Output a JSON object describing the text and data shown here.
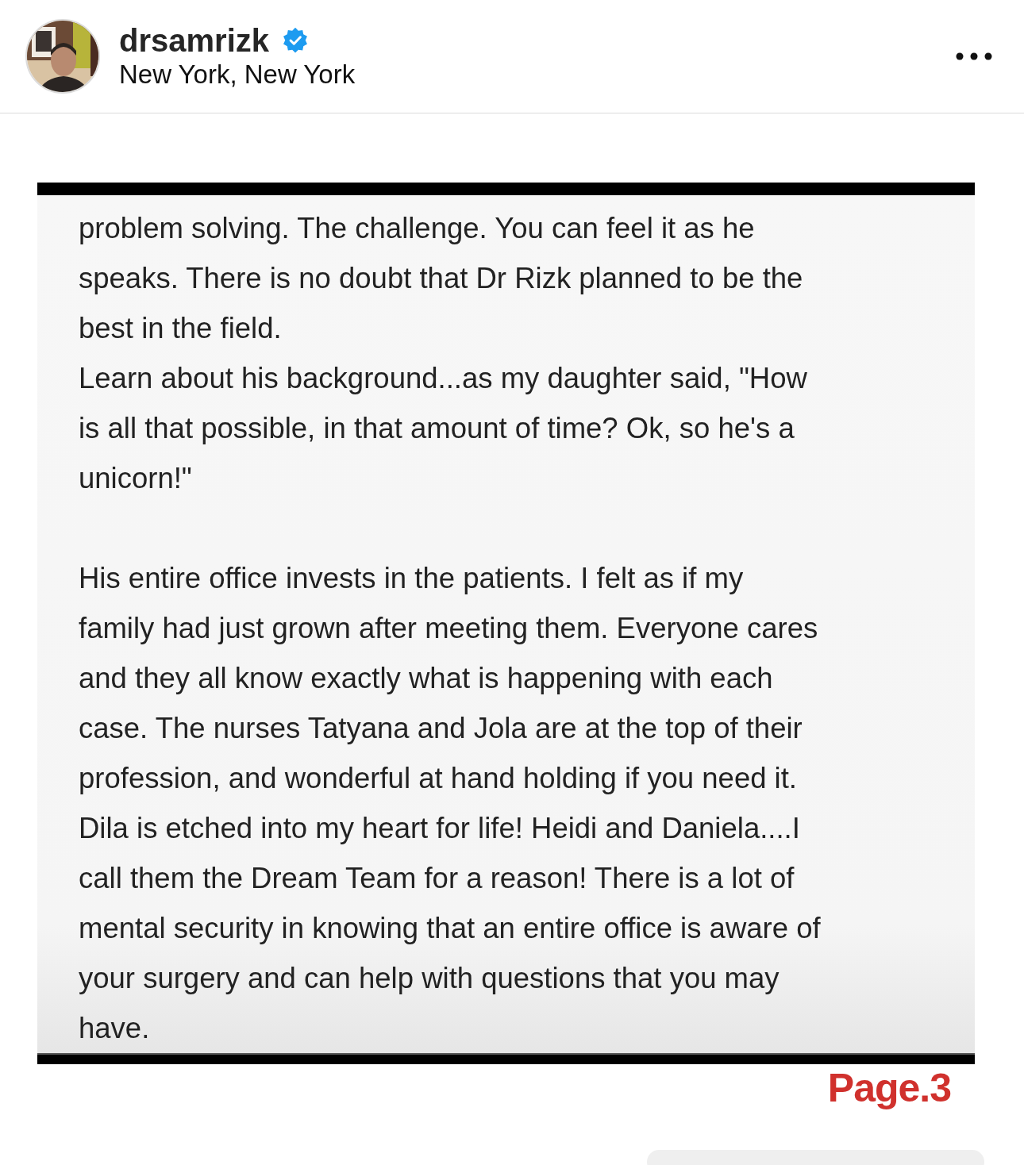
{
  "post_header": {
    "username": "drsamrizk",
    "verified": true,
    "location": "New York, New York"
  },
  "post_image": {
    "sections": [
      {
        "paragraphs": [
          {
            "lines": [
              "problem solving. The challenge. You can feel it as he",
              "speaks. There is no doubt that Dr Rizk planned to be the",
              "best in the field."
            ]
          },
          {
            "lines": [
              "Learn about his background...as my daughter said, \"How",
              "is all that possible, in that amount of time? Ok, so he's a",
              "unicorn!\""
            ]
          }
        ]
      },
      {
        "paragraphs": [
          {
            "lines": [
              "His entire office invests in the patients. I felt as if my",
              "family had just grown after meeting them. Everyone cares",
              "and they all know exactly what is happening with each",
              "case. The nurses Tatyana and Jola are at the top of their",
              "profession, and wonderful at hand holding if you need it.",
              "Dila is etched into my heart for life!  Heidi and Daniela....I",
              "call them the Dream Team for a reason! There is a lot of",
              "mental security in knowing that an entire office is aware of",
              "your surgery  and can help with questions that you may",
              "have."
            ]
          }
        ]
      }
    ],
    "page_label": "Page.3"
  }
}
